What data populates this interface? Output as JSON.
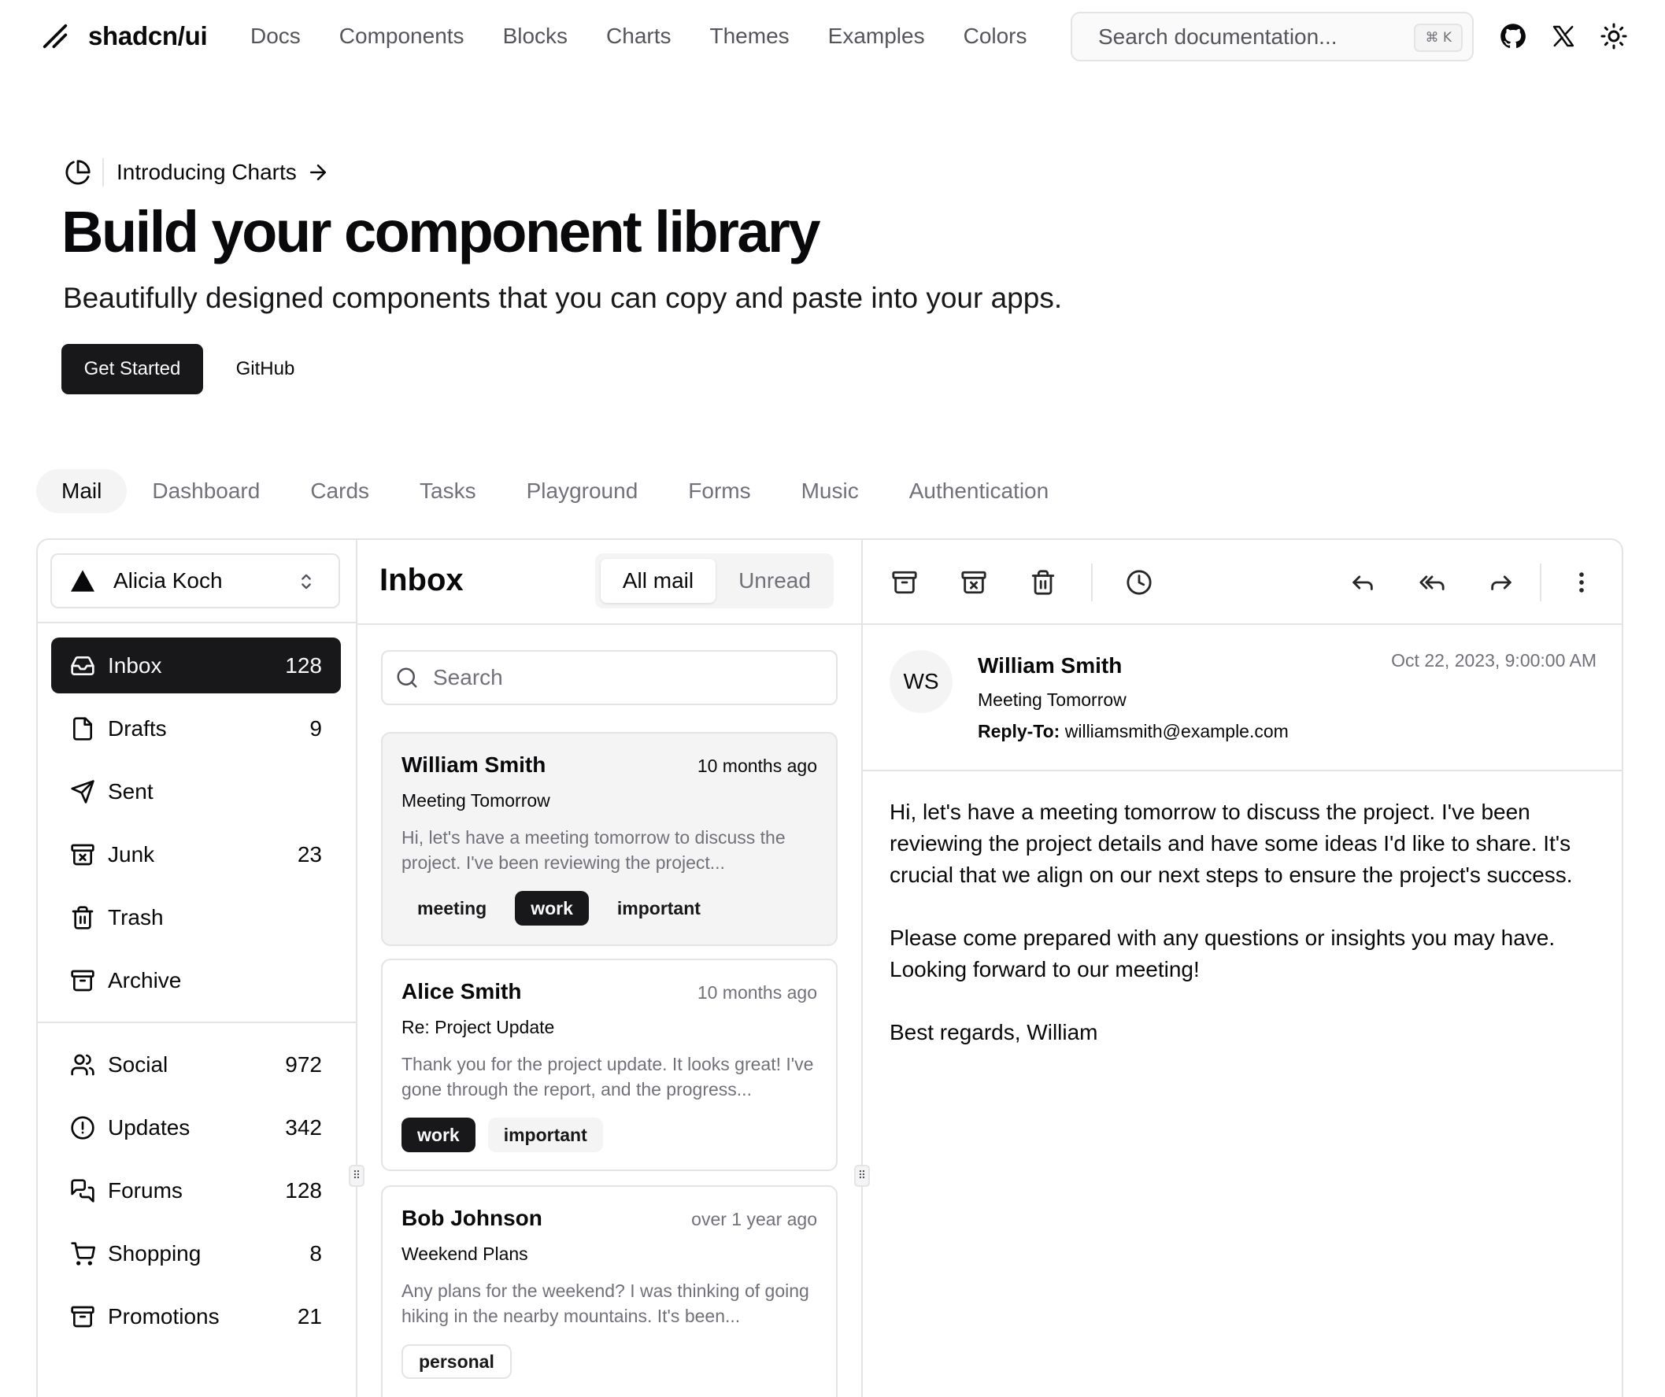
{
  "navbar": {
    "logo_text": "shadcn/ui",
    "links": [
      "Docs",
      "Components",
      "Blocks",
      "Charts",
      "Themes",
      "Examples",
      "Colors"
    ],
    "search_placeholder": "Search documentation...",
    "search_shortcut": "⌘ K",
    "icons": [
      "github-icon",
      "x-icon",
      "sun-icon"
    ]
  },
  "hero": {
    "announcement": "Introducing Charts",
    "title": "Build your component library",
    "subtitle": "Beautifully designed components that you can copy and paste into your apps.",
    "primary_button": "Get Started",
    "secondary_button": "GitHub"
  },
  "example_tabs": [
    "Mail",
    "Dashboard",
    "Cards",
    "Tasks",
    "Playground",
    "Forms",
    "Music",
    "Authentication"
  ],
  "mail": {
    "account": "Alicia Koch",
    "folders": [
      {
        "label": "Inbox",
        "count": "128",
        "icon": "inbox-icon"
      },
      {
        "label": "Drafts",
        "count": "9",
        "icon": "file-icon"
      },
      {
        "label": "Sent",
        "count": "",
        "icon": "send-icon"
      },
      {
        "label": "Junk",
        "count": "23",
        "icon": "archive-x-icon"
      },
      {
        "label": "Trash",
        "count": "",
        "icon": "trash-icon"
      },
      {
        "label": "Archive",
        "count": "",
        "icon": "archive-icon"
      }
    ],
    "categories": [
      {
        "label": "Social",
        "count": "972",
        "icon": "users-icon"
      },
      {
        "label": "Updates",
        "count": "342",
        "icon": "alert-circle-icon"
      },
      {
        "label": "Forums",
        "count": "128",
        "icon": "messages-icon"
      },
      {
        "label": "Shopping",
        "count": "8",
        "icon": "cart-icon"
      },
      {
        "label": "Promotions",
        "count": "21",
        "icon": "archive-icon"
      }
    ],
    "list_title": "Inbox",
    "toggle": {
      "all": "All mail",
      "unread": "Unread"
    },
    "search_placeholder": "Search",
    "messages": [
      {
        "from": "William Smith",
        "date": "10 months ago",
        "subject": "Meeting Tomorrow",
        "preview": "Hi, let's have a meeting tomorrow to discuss the project. I've been reviewing the project...",
        "tags": [
          "meeting",
          "work",
          "important"
        ]
      },
      {
        "from": "Alice Smith",
        "date": "10 months ago",
        "subject": "Re: Project Update",
        "preview": "Thank you for the project update. It looks great! I've gone through the report, and the progress...",
        "tags": [
          "work",
          "important"
        ]
      },
      {
        "from": "Bob Johnson",
        "date": "over 1 year ago",
        "subject": "Weekend Plans",
        "preview": "Any plans for the weekend? I was thinking of going hiking in the nearby mountains. It's been...",
        "tags": [
          "personal"
        ]
      }
    ],
    "reader": {
      "initials": "WS",
      "from": "William Smith",
      "subject": "Meeting Tomorrow",
      "reply_to_label": "Reply-To:",
      "reply_to": "williamsmith@example.com",
      "date": "Oct 22, 2023, 9:00:00 AM",
      "body": [
        "Hi, let's have a meeting tomorrow to discuss the project. I've been reviewing the project details and have some ideas I'd like to share. It's crucial that we align on our next steps to ensure the project's success.",
        "Please come prepared with any questions or insights you may have. Looking forward to our meeting!",
        "Best regards, William"
      ]
    },
    "toolbar_icons": [
      "archive-icon",
      "archive-x-icon",
      "trash-icon",
      "clock-icon",
      "reply-icon",
      "reply-all-icon",
      "forward-icon",
      "more-vertical-icon"
    ]
  }
}
